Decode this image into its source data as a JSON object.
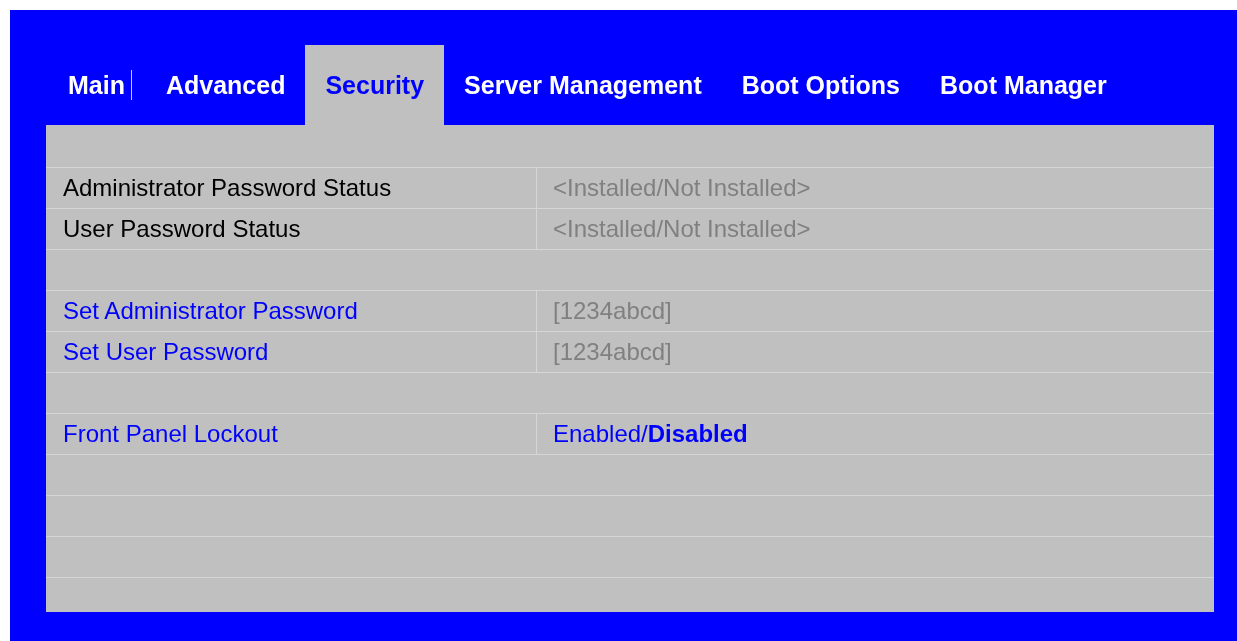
{
  "tabs": [
    {
      "label": "Main",
      "selected": false
    },
    {
      "label": "Advanced",
      "selected": false
    },
    {
      "label": "Security",
      "selected": true
    },
    {
      "label": "Server Management",
      "selected": false
    },
    {
      "label": "Boot Options",
      "selected": false
    },
    {
      "label": "Boot Manager",
      "selected": false
    }
  ],
  "groups": [
    [
      {
        "kind": "status",
        "label": "Administrator Password Status",
        "value": "<Installed/Not Installed>"
      },
      {
        "kind": "status",
        "label": "User Password Status",
        "value": "<Installed/Not Installed>"
      }
    ],
    [
      {
        "kind": "password",
        "label": "Set Administrator Password",
        "value": "[1234abcd]"
      },
      {
        "kind": "password",
        "label": "Set User Password",
        "value": "[1234abcd]"
      }
    ],
    [
      {
        "kind": "option",
        "label": "Front Panel Lockout",
        "value": "Enabled/**Disabled**"
      }
    ]
  ]
}
